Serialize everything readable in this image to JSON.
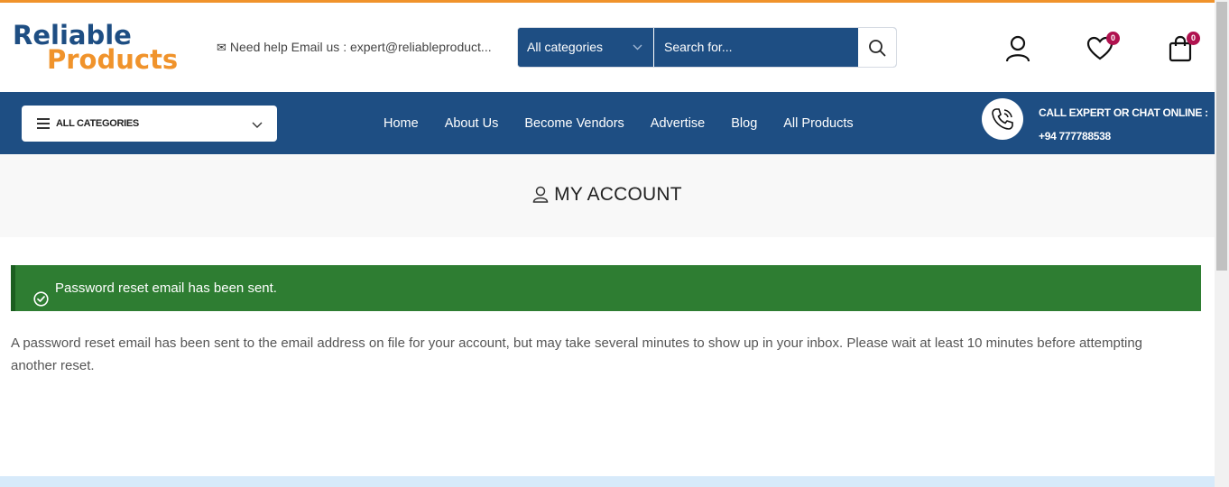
{
  "brand": {
    "line1": "Reliable",
    "line2": "Products",
    "primary": "#1e4e83",
    "accent": "#f0932b"
  },
  "header": {
    "help_icon": "mail-icon",
    "help_text": "Need help Email us : expert@reliableproduct...",
    "search": {
      "category": "All categories",
      "placeholder": "Search for..."
    },
    "wishlist_count": "0",
    "cart_count": "0"
  },
  "nav": {
    "all_categories": "ALL CATEGORIES",
    "items": [
      "Home",
      "About Us",
      "Become Vendors",
      "Advertise",
      "Blog",
      "All Products"
    ],
    "call_label": "CALL EXPERT OR CHAT ONLINE :",
    "call_number": "+94 777788538"
  },
  "page": {
    "title": "MY ACCOUNT",
    "notice": "Password reset email has been sent.",
    "notice_color": "#2e7d32",
    "message": "A password reset email has been sent to the email address on file for your account, but may take several minutes to show up in your inbox. Please wait at least 10 minutes before attempting another reset."
  }
}
